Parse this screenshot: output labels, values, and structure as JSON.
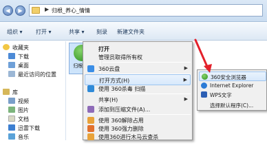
{
  "address_bar": {
    "separator": "▶",
    "path": "归根_养心_情情"
  },
  "toolbar": {
    "organize_label": "组织 ▾",
    "open_label": "打开 ▾",
    "share_label": "共享 ▾",
    "burn_label": "刻录",
    "new_folder_label": "新建文件夹"
  },
  "sidebar": {
    "favorites": {
      "label": "收藏夹",
      "items": [
        "下载",
        "桌面",
        "最近访问的位置"
      ]
    },
    "libraries": {
      "label": "库",
      "items": [
        "视频",
        "图片",
        "文档",
        "迅雷下载",
        "音乐"
      ]
    }
  },
  "file": {
    "name": "归根_养心"
  },
  "context_menu": {
    "items": [
      {
        "label": "打开",
        "bold": true
      },
      {
        "label": "管理员取得所有权"
      },
      {
        "label": "360云盘"
      },
      {
        "label": "打开方式(H)"
      },
      {
        "label": "使用 360杀毒 扫描"
      },
      {
        "label": "共享(H)"
      },
      {
        "label": "添加到压缩文件(A)..."
      },
      {
        "label": "使用 360解除占用"
      },
      {
        "label": "使用 360强力删除"
      },
      {
        "label": "使用360进行木马云查杀"
      }
    ]
  },
  "submenu": {
    "items": [
      {
        "label": "360安全浏览器"
      },
      {
        "label": "Internet Explorer"
      },
      {
        "label": "WPS文字"
      },
      {
        "label": "选择默认程序(C)..."
      }
    ]
  },
  "colors": {
    "arrow": "#e3212b",
    "highlight": "#d7e8fb"
  }
}
